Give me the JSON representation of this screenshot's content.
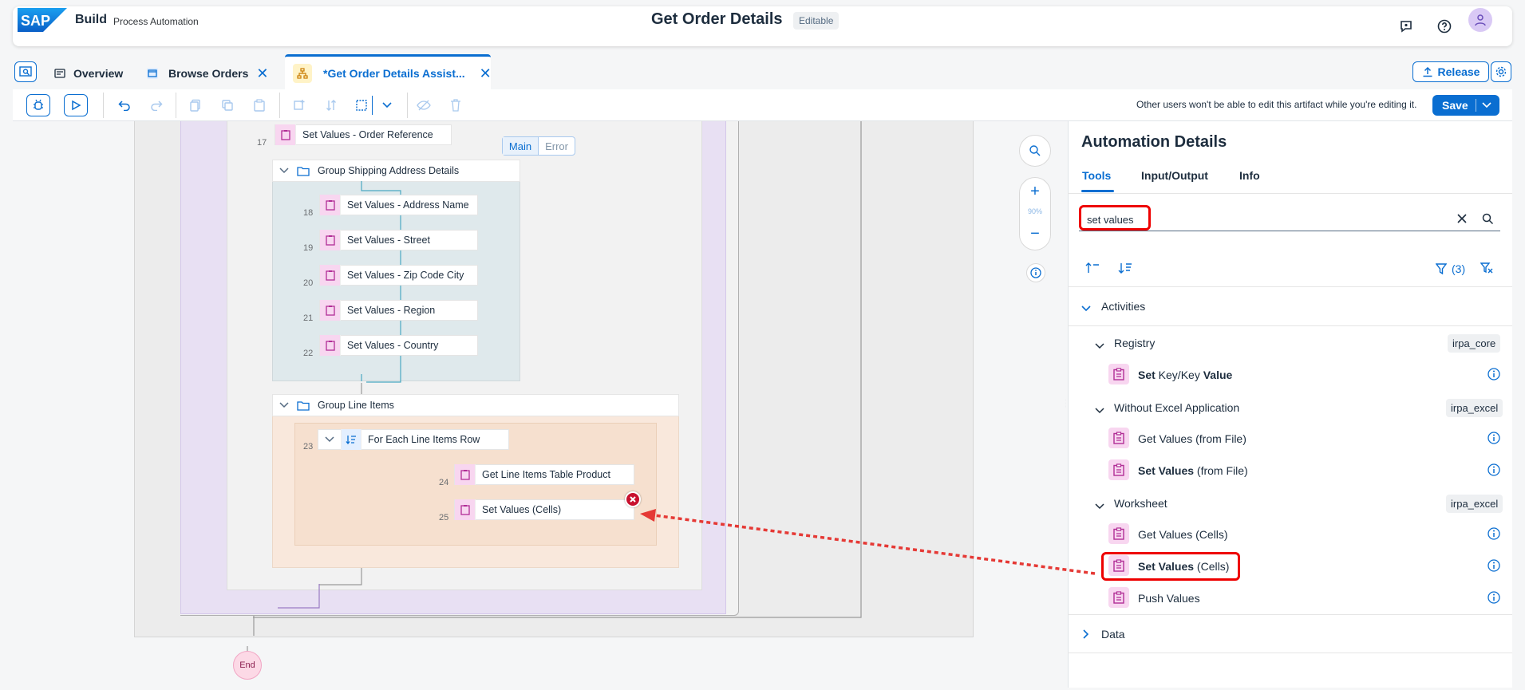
{
  "shell": {
    "brand": "Build",
    "product": "Process Automation",
    "doc_title": "Get Order Details",
    "doc_status": "Editable"
  },
  "tabs": {
    "overview": "Overview",
    "browse_orders": "Browse Orders",
    "active": "*Get Order Details Assist..."
  },
  "header_actions": {
    "release": "Release"
  },
  "toolbar": {
    "lock_note": "Other users won't be able to edit this artifact while you're editing it.",
    "save": "Save"
  },
  "canvas": {
    "switch_main": "Main",
    "switch_error": "Error",
    "zoom_level": "90%",
    "end_label": "End",
    "nodes": [
      {
        "line": "17",
        "label": "Set Values - Order Reference"
      },
      {
        "line": "18",
        "label": "Set Values - Address Name"
      },
      {
        "line": "19",
        "label": "Set Values - Street"
      },
      {
        "line": "20",
        "label": "Set Values - Zip Code City"
      },
      {
        "line": "21",
        "label": "Set Values - Region"
      },
      {
        "line": "22",
        "label": "Set Values - Country"
      },
      {
        "line": "23",
        "label": "For Each Line Items Row"
      },
      {
        "line": "24",
        "label": "Get Line Items Table Product"
      },
      {
        "line": "25",
        "label": "Set Values (Cells)"
      }
    ],
    "groups": {
      "shipping": "Group Shipping Address Details",
      "line_items": "Group Line Items"
    }
  },
  "panel": {
    "title": "Automation Details",
    "tabs": [
      "Tools",
      "Input/Output",
      "Info"
    ],
    "search_value": "set values",
    "filter_count": "(3)",
    "sections": {
      "activities": "Activities",
      "data": "Data"
    },
    "registry": {
      "label": "Registry",
      "badge": "irpa_core",
      "items": [
        {
          "bold": "Set",
          "regular": " Key/Key ",
          "bold2": "Value"
        }
      ]
    },
    "without_excel": {
      "label": "Without Excel Application",
      "badge": "irpa_excel",
      "items": [
        {
          "bold": "",
          "regular": "Get Values (from File)"
        },
        {
          "bold": "Set Values",
          "regular": " (from File)"
        }
      ]
    },
    "worksheet": {
      "label": "Worksheet",
      "badge": "irpa_excel",
      "items": [
        {
          "bold": "",
          "regular": "Get Values (Cells)"
        },
        {
          "bold": "Set Values",
          "regular": " (Cells)"
        },
        {
          "bold": "",
          "regular": "Push Values"
        }
      ]
    }
  },
  "colors": {
    "accent": "#0a6ed1",
    "highlight": "#e00000",
    "activity_icon_bg": "#f8d6f0"
  }
}
